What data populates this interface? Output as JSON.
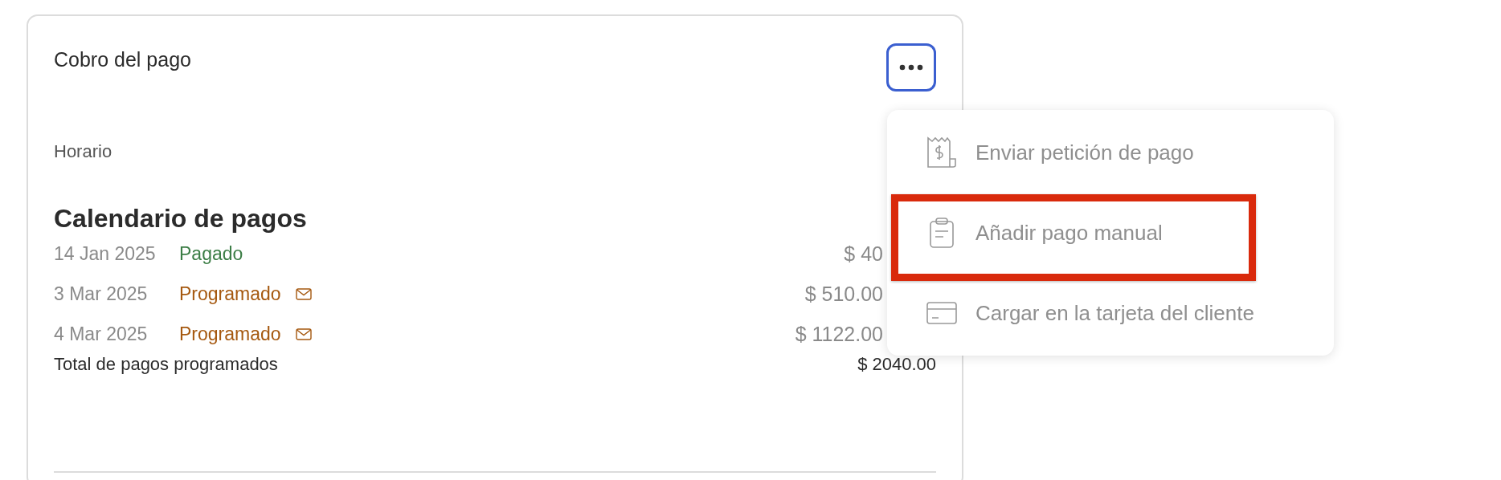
{
  "card": {
    "title": "Cobro del pago",
    "section_label": "Horario",
    "heading": "Calendario de pagos",
    "payments": [
      {
        "date": "14 Jan 2025",
        "status": "Pagado",
        "kind": "paid",
        "reminder": false,
        "amount": "$ 40"
      },
      {
        "date": "3 Mar 2025",
        "status": "Programado",
        "kind": "scheduled",
        "reminder": true,
        "amount": "$ 510.00"
      },
      {
        "date": "4 Mar 2025",
        "status": "Programado",
        "kind": "scheduled",
        "reminder": true,
        "amount": "$ 1122.00"
      }
    ],
    "total": {
      "label": "Total de pagos programados",
      "amount": "$ 2040.00"
    }
  },
  "menu": {
    "open": true,
    "items": [
      {
        "label": "Enviar petición de pago",
        "kind": "request",
        "highlighted": false
      },
      {
        "label": "Añadir pago manual",
        "kind": "manual",
        "highlighted": true
      },
      {
        "label": "Cargar en la tarjeta del cliente",
        "kind": "charge",
        "highlighted": false
      }
    ]
  }
}
